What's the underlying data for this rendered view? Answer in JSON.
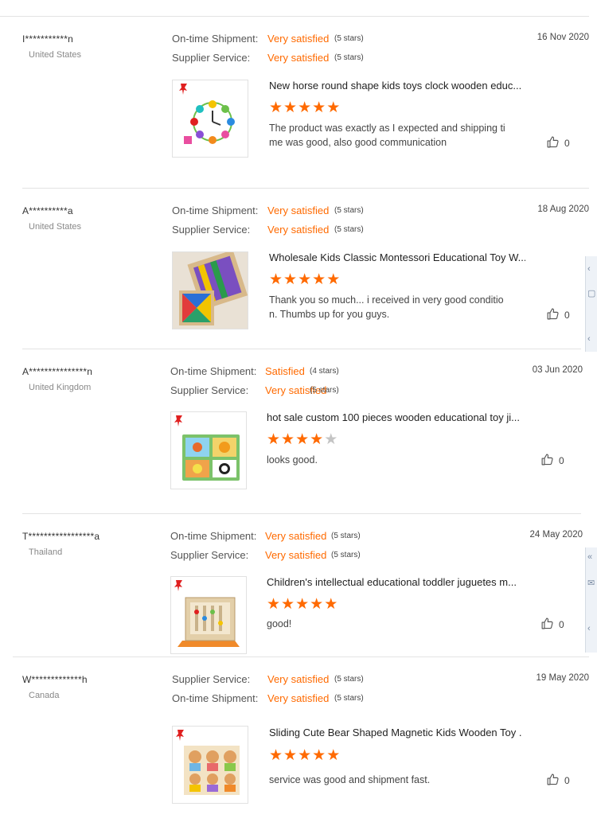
{
  "reviews": [
    {
      "user": "I***********n",
      "country": "United States",
      "date": "16 Nov 2020",
      "ratings": [
        {
          "label": "On-time Shipment:",
          "value": "Very satisfied",
          "stars": "(5 stars)"
        },
        {
          "label": "Supplier Service:",
          "value": "Very satisfied",
          "stars": "(5 stars)"
        }
      ],
      "product": "New horse round shape kids toys clock wooden educ...",
      "product_image": "clock-toy-image",
      "stars": 5,
      "comment": "The product was exactly as I expected and shipping time was good, also good communication",
      "likes": "0"
    },
    {
      "user": "A**********a",
      "country": "United States",
      "date": "18 Aug 2020",
      "ratings": [
        {
          "label": "On-time Shipment:",
          "value": "Very satisfied",
          "stars": "(5 stars)"
        },
        {
          "label": "Supplier Service:",
          "value": "Very satisfied",
          "stars": "(5 stars)"
        }
      ],
      "product": "Wholesale Kids Classic Montessori Educational Toy W...",
      "product_image": "tangram-toy-image",
      "stars": 5,
      "comment": "Thank you so much... i received in very good condition. Thumbs up for you guys.",
      "likes": "0"
    },
    {
      "user": "A***************n",
      "country": "United Kingdom",
      "date": "03 Jun 2020",
      "ratings": [
        {
          "label": "On-time Shipment:",
          "value": "Satisfied",
          "stars": "(4 stars)"
        },
        {
          "label": "Supplier Service:",
          "value": "Very satisfied",
          "stars": "(5 stars)"
        }
      ],
      "product": "hot sale custom 100 pieces wooden educational toy ji...",
      "product_image": "animal-puzzle-image",
      "stars": 4,
      "comment": "looks good.",
      "likes": "0"
    },
    {
      "user": "T*****************a",
      "country": "Thailand",
      "date": "24 May 2020",
      "ratings": [
        {
          "label": "On-time Shipment:",
          "value": "Very satisfied",
          "stars": "(5 stars)"
        },
        {
          "label": "Supplier Service:",
          "value": "Very satisfied",
          "stars": "(5 stars)"
        }
      ],
      "product": "Children's intellectual educational toddler juguetes m...",
      "product_image": "logic-board-image",
      "stars": 5,
      "comment": "good!",
      "likes": "0"
    },
    {
      "user": "W*************h",
      "country": "Canada",
      "date": "19 May 2020",
      "ratings": [
        {
          "label": "Supplier Service:",
          "value": "Very satisfied",
          "stars": "(5 stars)"
        },
        {
          "label": "On-time Shipment:",
          "value": "Very satisfied",
          "stars": "(5 stars)"
        }
      ],
      "product": "Sliding Cute Bear Shaped Magnetic Kids Wooden Toy ...",
      "product_image": "bear-puzzle-image",
      "stars": 5,
      "comment": "service was good and shipment fast.",
      "likes": "0"
    }
  ],
  "colors": {
    "accent": "#ff6a00",
    "star_off": "#c4c4c4"
  }
}
